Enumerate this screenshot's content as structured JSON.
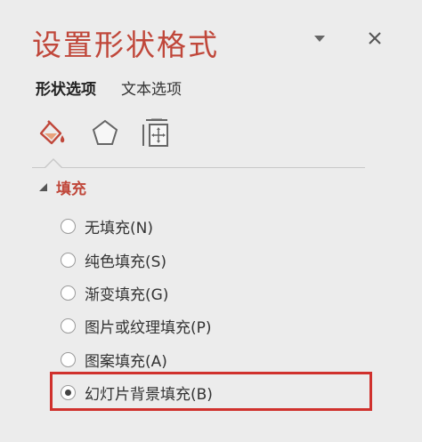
{
  "pane": {
    "title": "设置形状格式",
    "dropdown_icon": "triangle-down-icon",
    "close_icon": "close-icon"
  },
  "tabs": [
    {
      "label": "形状选项",
      "active": true
    },
    {
      "label": "文本选项",
      "active": false
    }
  ],
  "icons": [
    {
      "name": "fill-line-icon",
      "active": true
    },
    {
      "name": "effects-icon",
      "active": false
    },
    {
      "name": "size-properties-icon",
      "active": false
    }
  ],
  "section": {
    "title": "填充",
    "expanded": true
  },
  "options": [
    {
      "label": "无填充(N)",
      "selected": false
    },
    {
      "label": "纯色填充(S)",
      "selected": false
    },
    {
      "label": "渐变填充(G)",
      "selected": false
    },
    {
      "label": "图片或纹理填充(P)",
      "selected": false
    },
    {
      "label": "图案填充(A)",
      "selected": false
    },
    {
      "label": "幻灯片背景填充(B)",
      "selected": true
    }
  ],
  "colors": {
    "accent": "#c0473a",
    "highlight_border": "#d0312d",
    "background": "#ececec"
  }
}
